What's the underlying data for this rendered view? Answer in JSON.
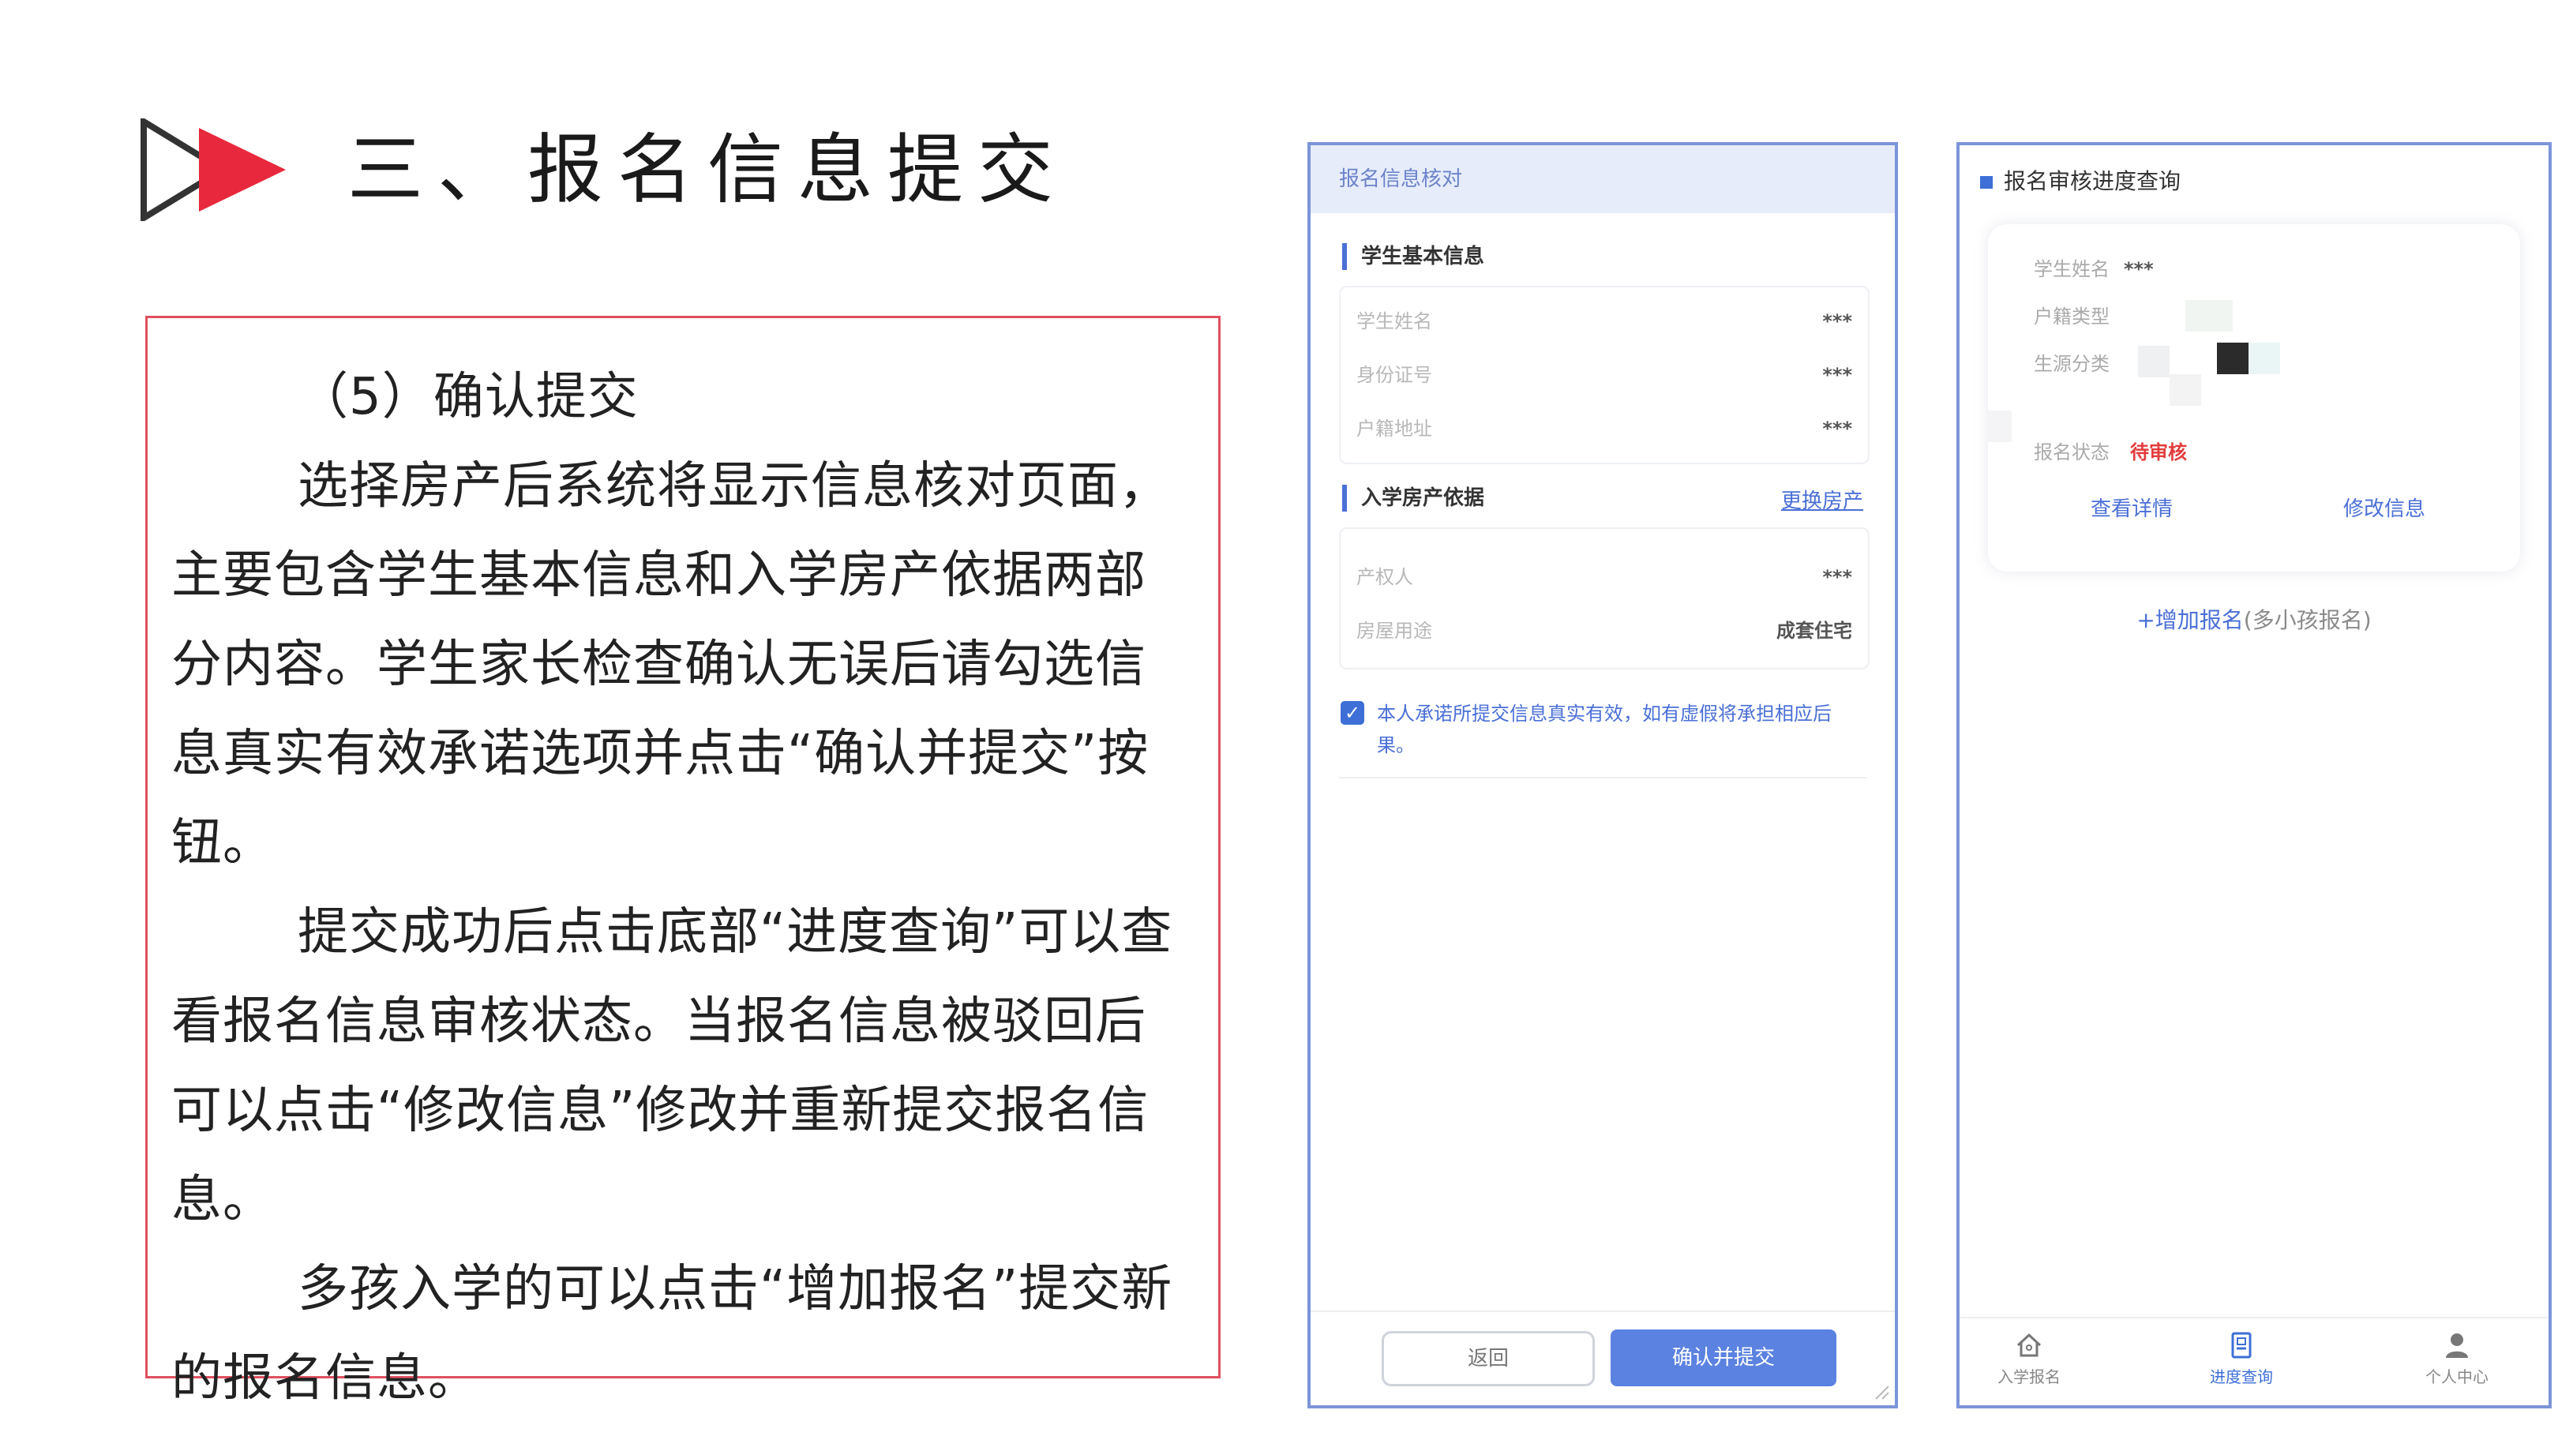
{
  "title": "三、报名信息提交",
  "instructions": {
    "heading": "（5）确认提交",
    "p1": "选择房产后系统将显示信息核对页面，主要包含学生基本信息和入学房产依据两部分内容。学生家长检查确认无误后请勾选信息真实有效承诺选项并点击“确认并提交”按钮。",
    "p2": "提交成功后点击底部“进度查询”可以查看报名信息审核状态。当报名信息被驳回后可以点击“修改信息”修改并重新提交报名信息。",
    "p3": "多孩入学的可以点击“增加报名”提交新的报名信息。"
  },
  "verify_page": {
    "header": "报名信息核对",
    "section1_title": "学生基本信息",
    "rows1": [
      {
        "label": "学生姓名",
        "value": "***"
      },
      {
        "label": "身份证号",
        "value": "***"
      },
      {
        "label": "户籍地址",
        "value": "***"
      }
    ],
    "section2_title": "入学房产依据",
    "change_link": "更换房产",
    "rows2": [
      {
        "label": "产权人",
        "value": "***"
      },
      {
        "label": "房屋用途",
        "value": "成套住宅"
      }
    ],
    "agreement": "本人承诺所提交信息真实有效，如有虚假将承担相应后果。",
    "back_button": "返回",
    "submit_button": "确认并提交"
  },
  "progress_page": {
    "title": "报名审核进度查询",
    "rows": [
      {
        "label": "学生姓名",
        "value": "***"
      },
      {
        "label": "户籍类型",
        "value": ""
      },
      {
        "label": "生源分类",
        "value": ""
      }
    ],
    "status_label": "报名状态",
    "status_value": "待审核",
    "view_details": "查看详情",
    "modify_info": "修改信息",
    "add_reg_plus": "+增加报名",
    "add_reg_note": "(多小孩报名)",
    "nav": [
      {
        "label": "入学报名",
        "icon": "home-icon"
      },
      {
        "label": "进度查询",
        "icon": "document-icon"
      },
      {
        "label": "个人中心",
        "icon": "user-icon"
      }
    ],
    "active_nav": "进度查询"
  },
  "colors": {
    "accent": "#e8283c",
    "frame_border": "#e0505f",
    "phone_border": "#7c95d8",
    "primary_blue": "#3d6fd6",
    "pending_red": "#e23b3b"
  }
}
